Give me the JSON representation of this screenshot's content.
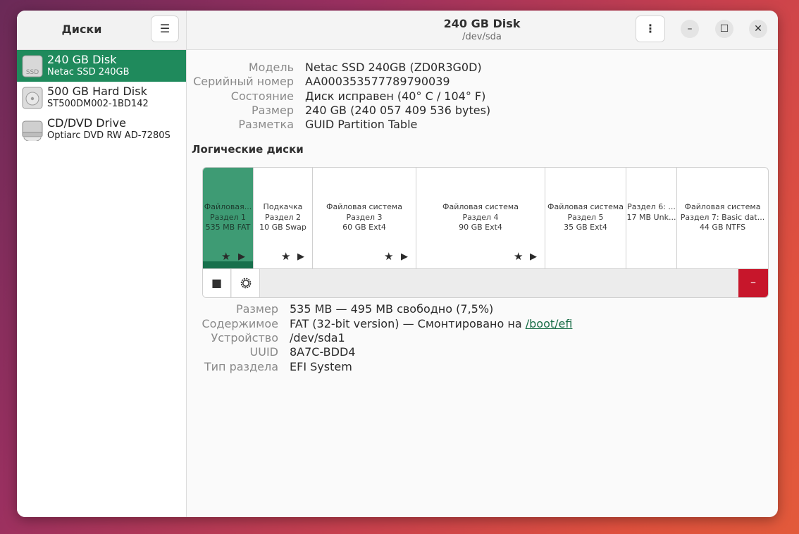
{
  "sidebar": {
    "title": "Диски",
    "menu_icon": "hamburger-menu-icon",
    "devices": [
      {
        "name": "240 GB Disk",
        "model": "Netac SSD 240GB",
        "icon": "ssd-icon",
        "icon_label": "SSD",
        "selected": true
      },
      {
        "name": "500 GB Hard Disk",
        "model": "ST500DM002-1BD142",
        "icon": "hard-disk-icon",
        "selected": false
      },
      {
        "name": "CD/DVD Drive",
        "model": "Optiarc DVD RW AD-7280S",
        "icon": "optical-drive-icon",
        "selected": false
      }
    ]
  },
  "header": {
    "title": "240 GB Disk",
    "subtitle": "/dev/sda",
    "menu_icon": "kebab-menu-icon",
    "minimize": "–",
    "maximize": "☐",
    "close": "✕"
  },
  "disk_info": [
    {
      "label": "Модель",
      "value": "Netac SSD 240GB (ZD0R3G0D)"
    },
    {
      "label": "Серийный номер",
      "value": "AA000353577789790039"
    },
    {
      "label": "Состояние",
      "value": "Диск исправен (40° C / 104° F)"
    },
    {
      "label": "Размер",
      "value": "240 GB (240 057 409 536 bytes)"
    },
    {
      "label": "Разметка",
      "value": "GUID Partition Table"
    }
  ],
  "volumes_title": "Логические диски",
  "partitions": [
    {
      "line1": "Файловая...",
      "line2": "Раздел 1",
      "line3": "535 MB FAT",
      "selected": true,
      "mounted": true
    },
    {
      "line1": "Подкачка",
      "line2": "Раздел 2",
      "line3": "10 GB Swap",
      "selected": false,
      "mounted": true
    },
    {
      "line1": "Файловая система",
      "line2": "Раздел 3",
      "line3": "60 GB Ext4",
      "selected": false,
      "mounted": true
    },
    {
      "line1": "Файловая система",
      "line2": "Раздел 4",
      "line3": "90 GB Ext4",
      "selected": false,
      "mounted": true
    },
    {
      "line1": "Файловая система",
      "line2": "Раздел 5",
      "line3": "35 GB Ext4",
      "selected": false,
      "mounted": false
    },
    {
      "line1": "Раздел 6: ...",
      "line2": "17 MB Unk...",
      "line3": "",
      "selected": false,
      "mounted": false
    },
    {
      "line1": "Файловая система",
      "line2": "Раздел 7: Basic dat...",
      "line3": "44 GB NTFS",
      "selected": false,
      "mounted": false
    }
  ],
  "partition_toolbar": {
    "stop_icon": "stop-icon",
    "settings_icon": "gear-icon",
    "delete_icon": "minus-icon",
    "delete_label": "–"
  },
  "partition_info": [
    {
      "label": "Размер",
      "value": "535 MB — 495 MB свободно (7,5%)"
    },
    {
      "label": "Содержимое",
      "value": "FAT (32-bit version) — Смонтировано на ",
      "link": "/boot/efi"
    },
    {
      "label": "Устройство",
      "value": "/dev/sda1"
    },
    {
      "label": "UUID",
      "value": "8A7C-BDD4"
    },
    {
      "label": "Тип раздела",
      "value": "EFI System"
    }
  ],
  "colors": {
    "accent": "#1f8a5c",
    "partition_selected": "#3e9b74",
    "delete_red": "#c7162b",
    "link": "#1a6e48"
  }
}
